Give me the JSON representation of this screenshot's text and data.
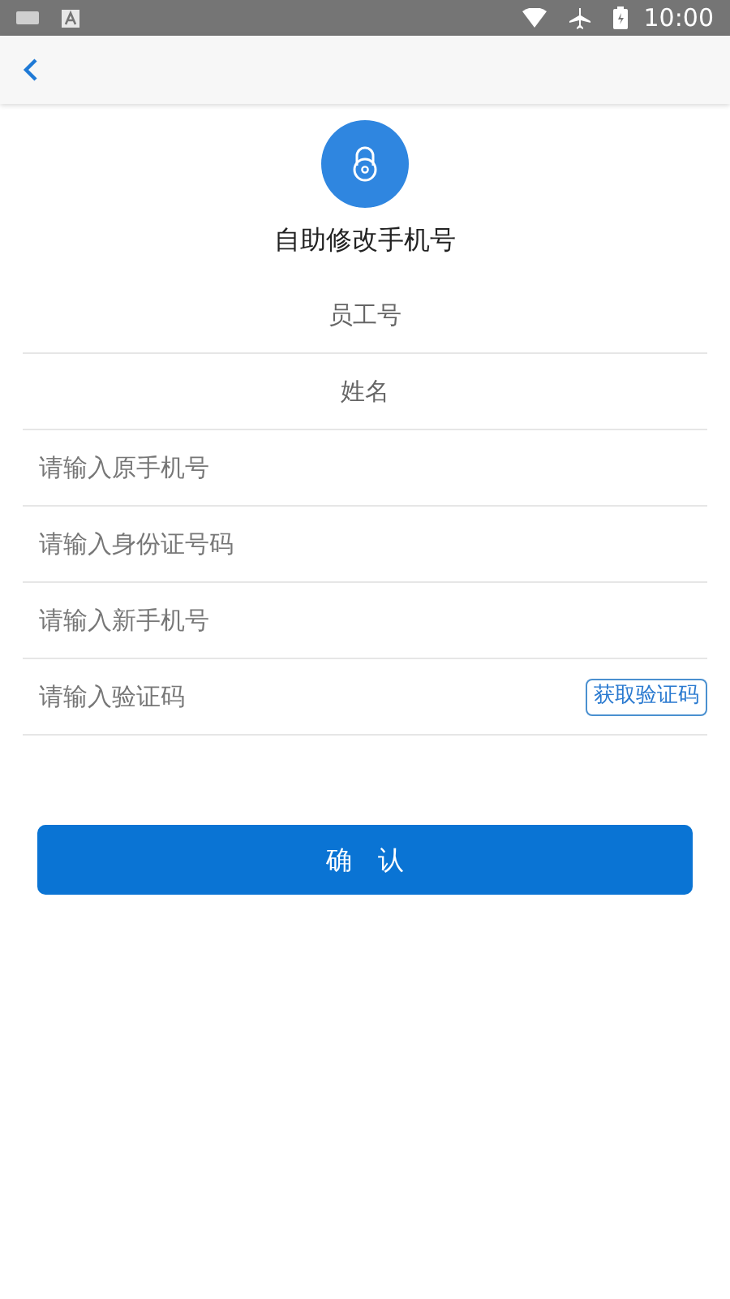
{
  "status_bar": {
    "time": "10:00"
  },
  "page": {
    "title": "自助修改手机号"
  },
  "fields": [
    {
      "kind": "display",
      "value": "员工号"
    },
    {
      "kind": "display",
      "value": "姓名"
    },
    {
      "kind": "input",
      "placeholder": "请输入原手机号"
    },
    {
      "kind": "input",
      "placeholder": "请输入身份证号码"
    },
    {
      "kind": "input",
      "placeholder": "请输入新手机号"
    },
    {
      "kind": "code",
      "placeholder": "请输入验证码",
      "button": "获取验证码"
    }
  ],
  "submit": {
    "label": "确　认"
  }
}
